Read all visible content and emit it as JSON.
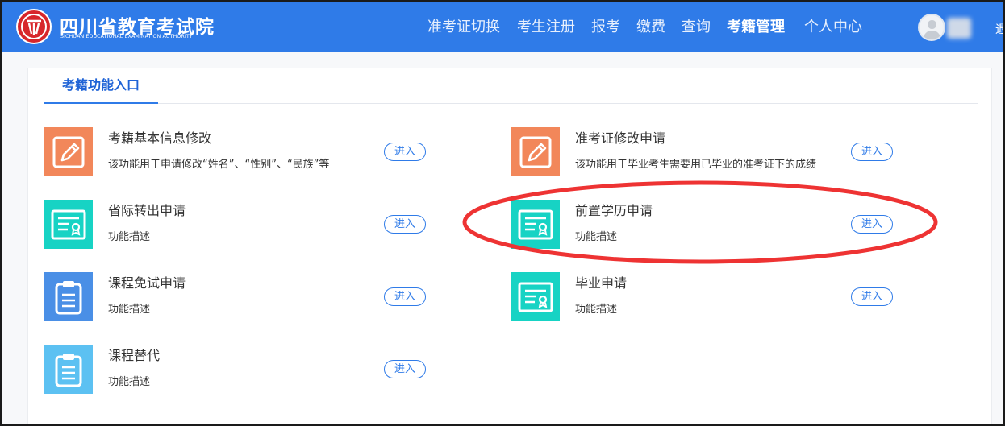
{
  "header": {
    "logo_cn": "四川省教育考试院",
    "logo_en": "SICHUAN EDUCATIONAL EXAMINATION AUTHORITY",
    "logo_icon": "institution-seal-icon",
    "nav": [
      {
        "label": "准考证切换",
        "active": false
      },
      {
        "label": "考生注册",
        "active": false
      },
      {
        "label": "报考",
        "active": false
      },
      {
        "label": "缴费",
        "active": false
      },
      {
        "label": "查询",
        "active": false
      },
      {
        "label": "考籍管理",
        "active": true
      },
      {
        "label": "个人中心",
        "active": false
      }
    ],
    "avatar_icon": "user-avatar-icon",
    "exit_partial": "退"
  },
  "panel": {
    "tab_label": "考籍功能入口"
  },
  "functions": [
    {
      "title": "考籍基本信息修改",
      "desc": "该功能用于申请修改“姓名”、“性别”、“民族”等",
      "icon": "edit-icon",
      "color": "#f2875a",
      "enter": "进入"
    },
    {
      "title": "准考证修改申请",
      "desc": "该功能用于毕业考生需要用已毕业的准考证下的成绩",
      "icon": "edit-icon",
      "color": "#f2875a",
      "enter": "进入"
    },
    {
      "title": "省际转出申请",
      "desc": "功能描述",
      "icon": "certificate-icon",
      "color": "#17d3c4",
      "enter": "进入"
    },
    {
      "title": "前置学历申请",
      "desc": "功能描述",
      "icon": "certificate-icon",
      "color": "#17d3c4",
      "enter": "进入"
    },
    {
      "title": "课程免试申请",
      "desc": "功能描述",
      "icon": "clipboard-icon",
      "color": "#4a8fe6",
      "enter": "进入"
    },
    {
      "title": "毕业申请",
      "desc": "功能描述",
      "icon": "certificate-icon",
      "color": "#17d3c4",
      "enter": "进入"
    },
    {
      "title": "课程替代",
      "desc": "功能描述",
      "icon": "clipboard-icon",
      "color": "#5cc1f2",
      "enter": "进入"
    }
  ],
  "colors": {
    "header_bg": "#2f7be8",
    "accent": "#2f7be8",
    "annotation": "#ee3333"
  }
}
